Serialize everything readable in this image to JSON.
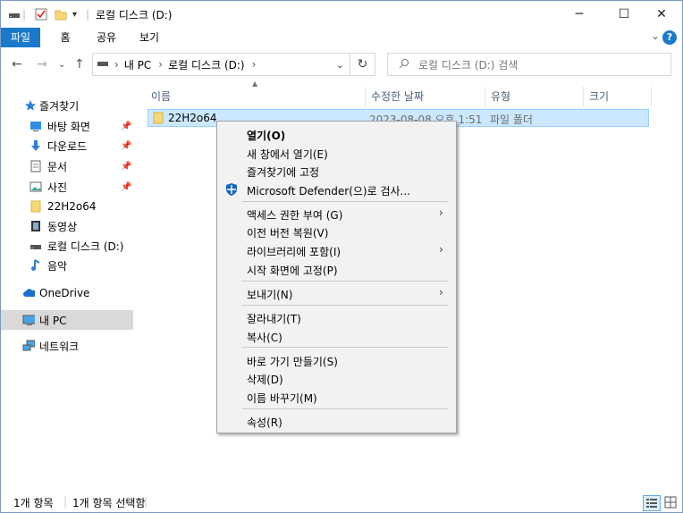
{
  "window": {
    "title": "로컬 디스크 (D:)"
  },
  "ribbon": {
    "tabs": [
      "파일",
      "홈",
      "공유",
      "보기"
    ]
  },
  "address": {
    "path": [
      "내 PC",
      "로컬 디스크 (D:)"
    ],
    "search_placeholder": "로컬 디스크 (D:) 검색"
  },
  "sidebar": {
    "items": [
      {
        "label": "즐겨찾기",
        "icon": "star-icon",
        "pinned": false
      },
      {
        "label": "바탕 화면",
        "icon": "desktop-icon",
        "pinned": true
      },
      {
        "label": "다운로드",
        "icon": "download-icon",
        "pinned": true
      },
      {
        "label": "문서",
        "icon": "document-icon",
        "pinned": true
      },
      {
        "label": "사진",
        "icon": "pictures-icon",
        "pinned": true
      },
      {
        "label": "22H2o64",
        "icon": "folder-icon",
        "pinned": false
      },
      {
        "label": "동영상",
        "icon": "video-icon",
        "pinned": false
      },
      {
        "label": "로컬 디스크 (D:)",
        "icon": "drive-icon",
        "pinned": false
      },
      {
        "label": "음악",
        "icon": "music-icon",
        "pinned": false
      },
      {
        "label": "OneDrive",
        "icon": "cloud-icon",
        "pinned": false
      },
      {
        "label": "내 PC",
        "icon": "pc-icon",
        "pinned": false
      },
      {
        "label": "네트워크",
        "icon": "network-icon",
        "pinned": false
      }
    ]
  },
  "columns": [
    "이름",
    "수정한 날짜",
    "유형",
    "크기"
  ],
  "files": [
    {
      "name": "22H2o64",
      "modified": "2023-08-08 오후 1:51",
      "type": "파일 폴더",
      "size": ""
    }
  ],
  "context_menu": {
    "items": [
      {
        "label": "열기(O)",
        "bold": true
      },
      {
        "label": "새 창에서 열기(E)"
      },
      {
        "label": "즐겨찾기에 고정"
      },
      {
        "label": "Microsoft Defender(으)로 검사...",
        "icon": "defender-shield-icon"
      },
      {
        "label": "액세스 권한 부여 (G)",
        "submenu": true
      },
      {
        "label": "이전 버전 복원(V)"
      },
      {
        "label": "라이브러리에 포함(I)",
        "submenu": true
      },
      {
        "label": "시작 화면에 고정(P)"
      },
      {
        "label": "보내기(N)",
        "submenu": true
      },
      {
        "label": "잘라내기(T)"
      },
      {
        "label": "복사(C)"
      },
      {
        "label": "바로 가기 만들기(S)"
      },
      {
        "label": "삭제(D)"
      },
      {
        "label": "이름 바꾸기(M)"
      },
      {
        "label": "속성(R)"
      }
    ]
  },
  "status": {
    "count": "1개 항목",
    "selected": "1개 항목 선택함"
  },
  "colors": {
    "accent": "#1979ca",
    "selection_bg": "#cce8ff",
    "selection_border": "#99d1ff",
    "nav_selected": "#d9d9d9",
    "menu_bg": "#f2f2f2"
  }
}
